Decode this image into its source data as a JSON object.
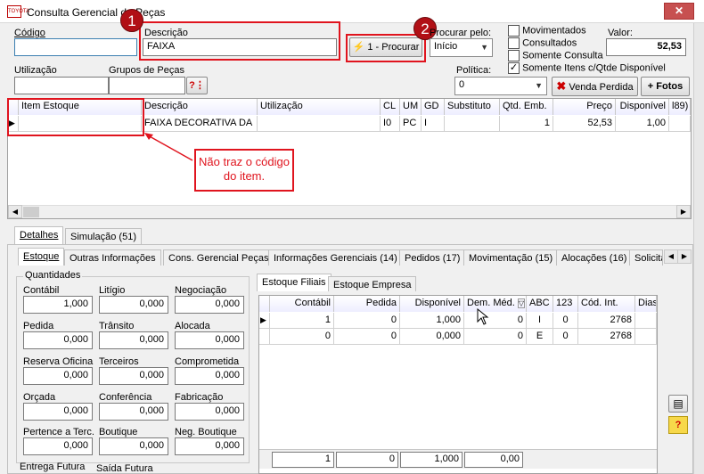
{
  "window": {
    "title": "Consulta Gerencial de Peças",
    "app_icon": "TOYOTA",
    "close": "✕"
  },
  "filters": {
    "codigo_label": "Código",
    "codigo_value": "",
    "descricao_label": "Descrição",
    "descricao_value": "FAIXA",
    "procurar_label": "1 - Procurar",
    "procurar_pelo_label": "Procurar pelo:",
    "procurar_pelo_value": "Início",
    "utilizacao_label": "Utilização",
    "utilizacao_value": "",
    "grupos_label": "Grupos de Peças",
    "grupos_value": "",
    "checkboxes": [
      {
        "label": "Movimentados",
        "mark": ""
      },
      {
        "label": "Consultados",
        "mark": ""
      },
      {
        "label": "Somente Consulta",
        "mark": ""
      },
      {
        "label": "Somente Itens c/Qtde Disponível",
        "mark": "✓"
      }
    ],
    "valor_label": "Valor:",
    "valor_value": "52,53",
    "politica_label": "Política:",
    "politica_value": "0",
    "venda_perdida_label": "Venda Perdida",
    "fotos_label": "+ Fotos"
  },
  "annotations": {
    "badge1": "1",
    "badge2": "2",
    "callout": "Não traz o código do item."
  },
  "results": {
    "headers": [
      "Item Estoque",
      "Descrição",
      "Utilização",
      "CL",
      "UM",
      "GD",
      "Substituto",
      "Qtd. Emb.",
      "Preço",
      "Disponível",
      "l89)"
    ],
    "row": [
      "",
      "FAIXA DECORATIVA DA",
      "",
      "I0",
      "PC",
      "I",
      "",
      "1",
      "52,53",
      "1,00",
      ""
    ]
  },
  "bottom_tabs": [
    "Detalhes",
    "Simulação (51)"
  ],
  "sub_tabs": [
    "Estoque",
    "Outras Informações",
    "Cons. Gerencial Peças",
    "Informações Gerenciais (14)",
    "Pedidos (17)",
    "Movimentação (15)",
    "Alocações (16)",
    "Solicita"
  ],
  "quantidades": {
    "title": "Quantidades",
    "fields": [
      {
        "label": "Contábil",
        "value": "1,000"
      },
      {
        "label": "Litígio",
        "value": "0,000"
      },
      {
        "label": "Negociação",
        "value": "0,000"
      },
      {
        "label": "Pedida",
        "value": "0,000"
      },
      {
        "label": "Trânsito",
        "value": "0,000"
      },
      {
        "label": "Alocada",
        "value": "0,000"
      },
      {
        "label": "Reserva Oficina",
        "value": "0,000"
      },
      {
        "label": "Terceiros",
        "value": "0,000"
      },
      {
        "label": "Comprometida",
        "value": "0,000"
      },
      {
        "label": "Orçada",
        "value": "0,000"
      },
      {
        "label": "Conferência",
        "value": "0,000"
      },
      {
        "label": "Fabricação",
        "value": "0,000"
      },
      {
        "label": "Pertence a Terc.",
        "value": "0,000"
      },
      {
        "label": "Boutique",
        "value": "0,000"
      },
      {
        "label": "Neg. Boutique",
        "value": "0,000"
      }
    ],
    "extra_labels": [
      "Entrega Futura",
      "Saída Futura"
    ]
  },
  "estoque_tabs": [
    "Estoque Filiais",
    "Estoque Empresa"
  ],
  "estoque_grid": {
    "headers": [
      "Contábil",
      "Pedida",
      "Disponível",
      "Dem. Méd.",
      "ABC",
      "123",
      "Cód. Int.",
      "Dias"
    ],
    "rows": [
      [
        "1",
        "0",
        "1,000",
        "0",
        "I",
        "0",
        "2768",
        ""
      ],
      [
        "0",
        "0",
        "0,000",
        "0",
        "E",
        "0",
        "2768",
        ""
      ]
    ],
    "totals": [
      "1",
      "0",
      "1,000",
      "0,00"
    ]
  },
  "side_icons": {
    "report": "report-icon",
    "help": "?"
  }
}
